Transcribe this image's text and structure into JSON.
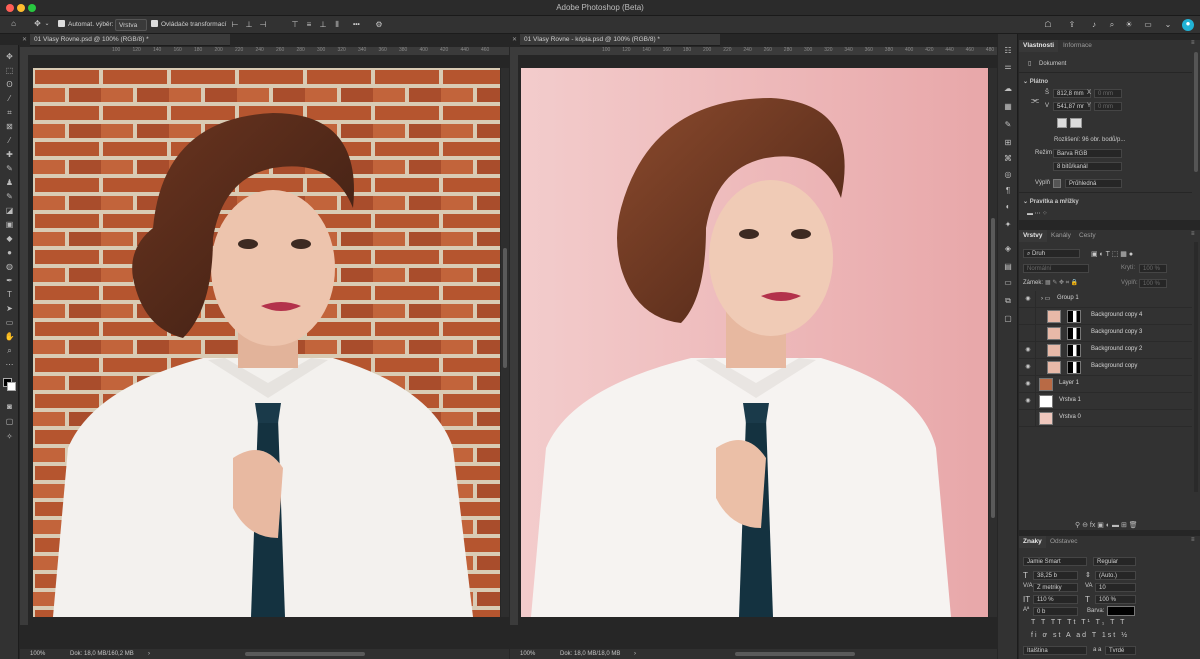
{
  "app": {
    "title": "Adobe Photoshop (Beta)"
  },
  "options": {
    "auto_select": "Automat. výběr:",
    "auto_select_value": "Vrstva",
    "transform": "Ovládače transformací",
    "more": "•••"
  },
  "documents": [
    {
      "tab": "01 Vlasy Rovne.psd @ 100% (RGB/8) *",
      "zoom": "100%",
      "status": "Dok: 18,0 MB/160,2 MB",
      "arrow": "›"
    },
    {
      "tab": "01 Vlasy Rovne - kópia.psd @ 100% (RGB/8) *",
      "zoom": "100%",
      "status": "Dok: 18,0 MB/18,0 MB",
      "arrow": "›"
    }
  ],
  "ruler": {
    "left_ticks": [
      "100",
      "120",
      "140",
      "160",
      "180",
      "200",
      "220",
      "240",
      "260",
      "280",
      "300",
      "320",
      "340",
      "360",
      "380",
      "400",
      "420",
      "440",
      "460"
    ],
    "right_ticks": [
      "100",
      "120",
      "140",
      "160",
      "180",
      "200",
      "220",
      "240",
      "260",
      "280",
      "300",
      "320",
      "340",
      "360",
      "380",
      "400",
      "420",
      "440",
      "460",
      "480"
    ]
  },
  "properties": {
    "tabs": [
      "Vlastnosti",
      "Informace"
    ],
    "doc_label": "Dokument",
    "canvas_section": "Plátno",
    "w_label": "Š",
    "w_value": "812,8 mm",
    "h_label": "V",
    "h_value": "541,87 mr",
    "x_label": "X",
    "x_value": "0 mm",
    "y_label": "Y",
    "y_value": "0 mm",
    "resolution": "Rozlišení: 96 obr. bodů/p...",
    "mode_label": "Režim",
    "mode_value": "Barva RGB",
    "bits_value": "8 bitů/kanál",
    "fill_label": "Výplň",
    "fill_value": "Průhledná",
    "rulers_section": "Pravítka a mřížky"
  },
  "layers": {
    "tabs": [
      "Vrstvy",
      "Kanály",
      "Cesty"
    ],
    "kind": "Druh",
    "blend": "Normální",
    "opacity_label": "Krytí:",
    "opacity_value": "100 %",
    "lock_label": "Zámek:",
    "fill_label": "Výplň:",
    "fill_value": "100 %",
    "items": [
      {
        "name": "Group 1",
        "visible": true
      },
      {
        "name": "Background copy 4",
        "visible": false
      },
      {
        "name": "Background copy 3",
        "visible": false
      },
      {
        "name": "Background copy 2",
        "visible": true
      },
      {
        "name": "Background copy",
        "visible": true
      },
      {
        "name": "Layer 1",
        "visible": true
      },
      {
        "name": "Vrstva 1",
        "visible": true
      },
      {
        "name": "Vrstva 0",
        "visible": false
      }
    ]
  },
  "character": {
    "tabs": [
      "Znaky",
      "Odstavec"
    ],
    "font": "Jamie Smart",
    "style": "Regular",
    "size": "38,25 b",
    "leading": "(Auto.)",
    "kerning": "Z metriky",
    "tracking": "10",
    "vscale": "110 %",
    "hscale": "100 %",
    "baseline": "0 b",
    "color_label": "Barva:",
    "language": "Italština",
    "aa_label": "a a",
    "aa_value": "Tvrdé"
  },
  "colors": {
    "accent": "#1a9bd7",
    "brick": "#b5552f",
    "pink": "#e8b4b4"
  }
}
